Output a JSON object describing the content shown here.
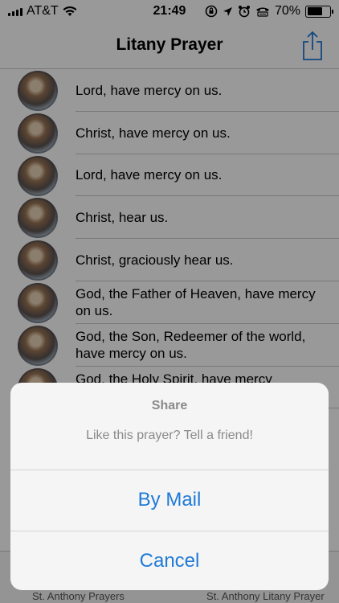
{
  "status_bar": {
    "carrier": "AT&T",
    "time": "21:49",
    "battery_text": "70%",
    "battery_level": 0.7
  },
  "nav": {
    "title": "Litany Prayer"
  },
  "list": {
    "items": [
      "Lord, have mercy on us.",
      "Christ, have mercy on us.",
      "Lord, have mercy on us.",
      "Christ, hear us.",
      "Christ, graciously hear us.",
      "God, the Father of Heaven, have mercy on us.",
      "God, the Son, Redeemer of the world, have mercy on us.",
      "God, the Holy Spirit, have mercy"
    ]
  },
  "tab_bar": {
    "left_label": "St. Anthony Prayers",
    "right_label": "St. Anthony Litany Prayer"
  },
  "sheet": {
    "title": "Share",
    "message": "Like this prayer? Tell a friend!",
    "mail_label": "By Mail",
    "cancel_label": "Cancel"
  },
  "colors": {
    "accent": "#1f7ad8",
    "dim_overlay": "rgba(0,0,0,0.4)"
  }
}
